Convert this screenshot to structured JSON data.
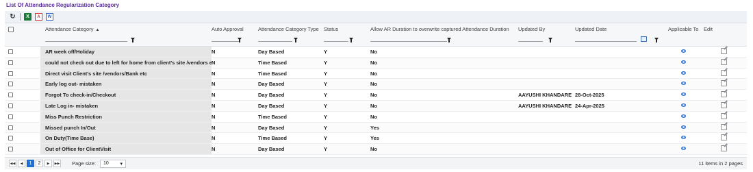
{
  "page_title": "List Of Attendance Regularization Category",
  "toolbar": {
    "refresh_icon": "refresh-icon",
    "excel_label": "X",
    "pdf_label": "A",
    "word_label": "W"
  },
  "columns": {
    "category": "Attendance Category",
    "auto_approval": "Auto Approval",
    "type": "Attendance Category Type",
    "status": "Status",
    "allow_ar": "Allow AR Duration to overwrite captured Attendance Duration",
    "updated_by": "Updated By",
    "updated_date": "Updated Date",
    "applicable_to": "Applicable To",
    "edit": "Edit"
  },
  "rows": [
    {
      "category": "AR week off/Holiday",
      "auto": "N",
      "type": "Day Based",
      "status": "Y",
      "allow": "No",
      "by": "",
      "date": ""
    },
    {
      "category": "could not check out due to left for home from client's site /vendors etc",
      "auto": "N",
      "type": "Time Based",
      "status": "Y",
      "allow": "No",
      "by": "",
      "date": ""
    },
    {
      "category": "Direct visit Client's site /vendors/Bank etc",
      "auto": "N",
      "type": "Time Based",
      "status": "Y",
      "allow": "No",
      "by": "",
      "date": ""
    },
    {
      "category": "Early log out- mistaken",
      "auto": "N",
      "type": "Day Based",
      "status": "Y",
      "allow": "No",
      "by": "",
      "date": ""
    },
    {
      "category": "Forgot To check-in/Checkout",
      "auto": "N",
      "type": "Day Based",
      "status": "Y",
      "allow": "No",
      "by": "AAYUSHI KHANDARE",
      "date": "28-Oct-2025"
    },
    {
      "category": "Late Log in- mistaken",
      "auto": "N",
      "type": "Day Based",
      "status": "Y",
      "allow": "No",
      "by": "AAYUSHI KHANDARE",
      "date": "24-Apr-2025"
    },
    {
      "category": "Miss Punch Restriction",
      "auto": "N",
      "type": "Time Based",
      "status": "Y",
      "allow": "No",
      "by": "",
      "date": ""
    },
    {
      "category": "Missed punch In/Out",
      "auto": "N",
      "type": "Day Based",
      "status": "Y",
      "allow": "Yes",
      "by": "",
      "date": ""
    },
    {
      "category": "On Duty(Time Base)",
      "auto": "N",
      "type": "Time Based",
      "status": "Y",
      "allow": "Yes",
      "by": "",
      "date": ""
    },
    {
      "category": "Out of Office for ClientVisit",
      "auto": "N",
      "type": "Day Based",
      "status": "Y",
      "allow": "No",
      "by": "",
      "date": ""
    }
  ],
  "pager": {
    "pages": [
      "1",
      "2"
    ],
    "current_page": "1",
    "page_size_label": "Page size:",
    "page_size": "10",
    "info": "11 items in 2 pages"
  },
  "colors": {
    "title": "#5b2ca0",
    "accent": "#1f6fd0",
    "category_bg": "#e6e6e6"
  }
}
